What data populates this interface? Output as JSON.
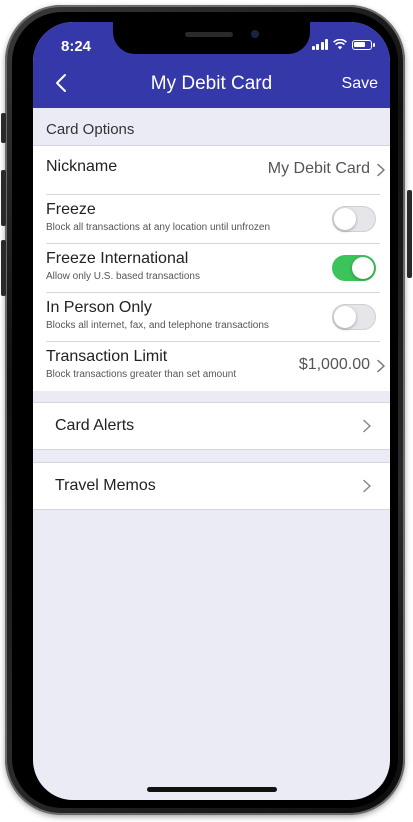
{
  "status_bar": {
    "time": "8:24"
  },
  "nav": {
    "title": "My Debit Card",
    "save_label": "Save"
  },
  "section": {
    "title": "Card Options"
  },
  "options": [
    {
      "title": "Nickname",
      "value": "My Debit Card"
    },
    {
      "title": "Freeze",
      "subtitle": "Block all transactions at any location until unfrozen",
      "enabled": false
    },
    {
      "title": "Freeze International",
      "subtitle": "Allow only U.S. based transactions",
      "enabled": true
    },
    {
      "title": "In Person Only",
      "subtitle": "Blocks all internet, fax, and telephone transactions",
      "enabled": false
    },
    {
      "title": "Transaction Limit",
      "subtitle": "Block transactions greater than set amount",
      "value": "$1,000.00"
    }
  ],
  "links": {
    "card_alerts": "Card Alerts",
    "travel_memos": "Travel Memos"
  },
  "colors": {
    "header": "#3538a8",
    "toggle_on": "#3cc35a",
    "background": "#ebebf6"
  }
}
